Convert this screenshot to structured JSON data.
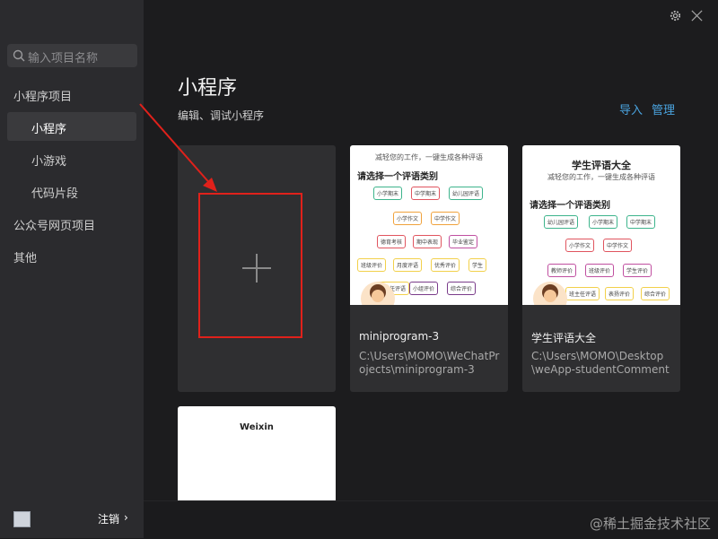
{
  "search": {
    "placeholder": "输入项目名称"
  },
  "sidebar": {
    "items": [
      {
        "label": "小程序项目"
      },
      {
        "label": "小程序"
      },
      {
        "label": "小游戏"
      },
      {
        "label": "代码片段"
      },
      {
        "label": "公众号网页项目"
      },
      {
        "label": "其他"
      }
    ],
    "logout_label": "注销",
    "logout_chevron": "›"
  },
  "main": {
    "title": "小程序",
    "subtitle": "编辑、调试小程序",
    "import_label": "导入",
    "manage_label": "管理"
  },
  "projects": [
    {
      "name": "miniprogram-3",
      "path": "C:\\Users\\MOMO\\WeChatProjects\\miniprogram-3",
      "thumb": {
        "line1": "减轻您的工作，一键生成各种评语",
        "heading": "请选择一个评语类别",
        "tags": [
          "小学期末",
          "中学期末",
          "幼儿园评语",
          "小学作文",
          "中学作文",
          "德育考核",
          "期中表现",
          "毕业鉴定",
          "班级评价",
          "月度评语",
          "优秀评价",
          "学生",
          "班主任评语",
          "小组评价",
          "综合评价"
        ]
      }
    },
    {
      "name": "学生评语大全",
      "path": "C:\\Users\\MOMO\\Desktop\\weApp-studentComment",
      "thumb": {
        "title": "学生评语大全",
        "line1": "减轻您的工作，一键生成各种评语",
        "heading": "请选择一个评语类别",
        "tags": [
          "幼儿园评语",
          "小学期末",
          "中学期末",
          "小学作文",
          "中学作文",
          "教师评价",
          "班级评价",
          "学生评价",
          "班主任评语",
          "表扬评价",
          "综合评价"
        ]
      }
    }
  ],
  "weixin_card": {
    "title": "Weixin"
  },
  "watermark": "@稀土掘金技术社区",
  "colors": {
    "accent": "#4aa3df",
    "highlight": "#e0211b",
    "sidebar_bg": "#2b2b2e",
    "main_bg": "#1c1c1e"
  },
  "icons": [
    "search-icon",
    "gear-icon",
    "close-icon",
    "plus-icon",
    "avatar",
    "chevron-right-icon"
  ]
}
